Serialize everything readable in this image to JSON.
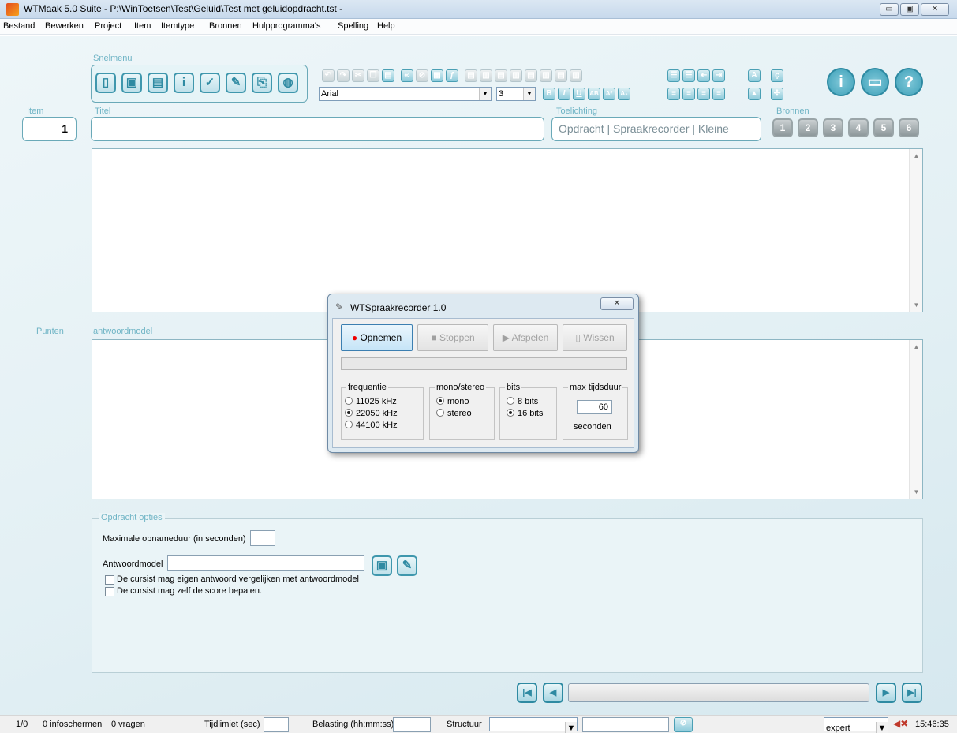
{
  "window": {
    "title": "WTMaak 5.0 Suite - P:\\WinToetsen\\Test\\Geluid\\Test met geluidopdracht.tst -",
    "min": "▭",
    "max": "▣",
    "close": "✕"
  },
  "menu": [
    "Bestand",
    "Bewerken",
    "Project",
    "Item",
    "Itemtype",
    "Bronnen",
    "Hulpprogramma's",
    "Spelling",
    "Help"
  ],
  "labels": {
    "snelmenu": "Snelmenu",
    "item": "Item",
    "titel": "Titel",
    "toelichting": "Toelichting",
    "bronnen": "Bronnen",
    "punten": "Punten",
    "antwoordmodel": "antwoordmodel"
  },
  "item_number": "1",
  "font_select": "Arial",
  "size_select": "3",
  "toelichting_value": "Opdracht | Spraakrecorder | Kleine",
  "bronnen_buttons": [
    "1",
    "2",
    "3",
    "4",
    "5",
    "6"
  ],
  "format_buttons": [
    "B",
    "I",
    "U",
    "AB",
    "A²",
    "A₂"
  ],
  "dialog": {
    "title": "WTSpraakrecorder 1.0",
    "close": "✕",
    "buttons": {
      "record": "Opnemen",
      "stop": "Stoppen",
      "play": "Afspelen",
      "clear": "Wissen"
    },
    "frequentie": {
      "legend": "frequentie",
      "options": [
        "11025 kHz",
        "22050 kHz",
        "44100 kHz"
      ],
      "selected": "22050 kHz"
    },
    "mono_stereo": {
      "legend": "mono/stereo",
      "options": [
        "mono",
        "stereo"
      ],
      "selected": "mono"
    },
    "bits": {
      "legend": "bits",
      "options": [
        "8 bits",
        "16 bits"
      ],
      "selected": "16 bits"
    },
    "max": {
      "legend": "max tijdsduur",
      "value": "60",
      "unit": "seconden"
    }
  },
  "options": {
    "legend": "Opdracht opties",
    "max_duration_label": "Maximale opnameduur (in seconden)",
    "max_duration_value": "",
    "antwoordmodel_label": "Antwoordmodel",
    "antwoordmodel_value": "",
    "check1": "De cursist mag eigen antwoord vergelijken met antwoordmodel",
    "check2": "De cursist mag zelf de score bepalen."
  },
  "status": {
    "position": "1/0",
    "infoschermen": "0 infoschermen",
    "vragen": "0 vragen",
    "tijdlimiet": "Tijdlimiet (sec)",
    "belasting": "Belasting (hh:mm:ss)",
    "structuur": "Structuur",
    "mode": "expert",
    "time": "15:46:35"
  }
}
